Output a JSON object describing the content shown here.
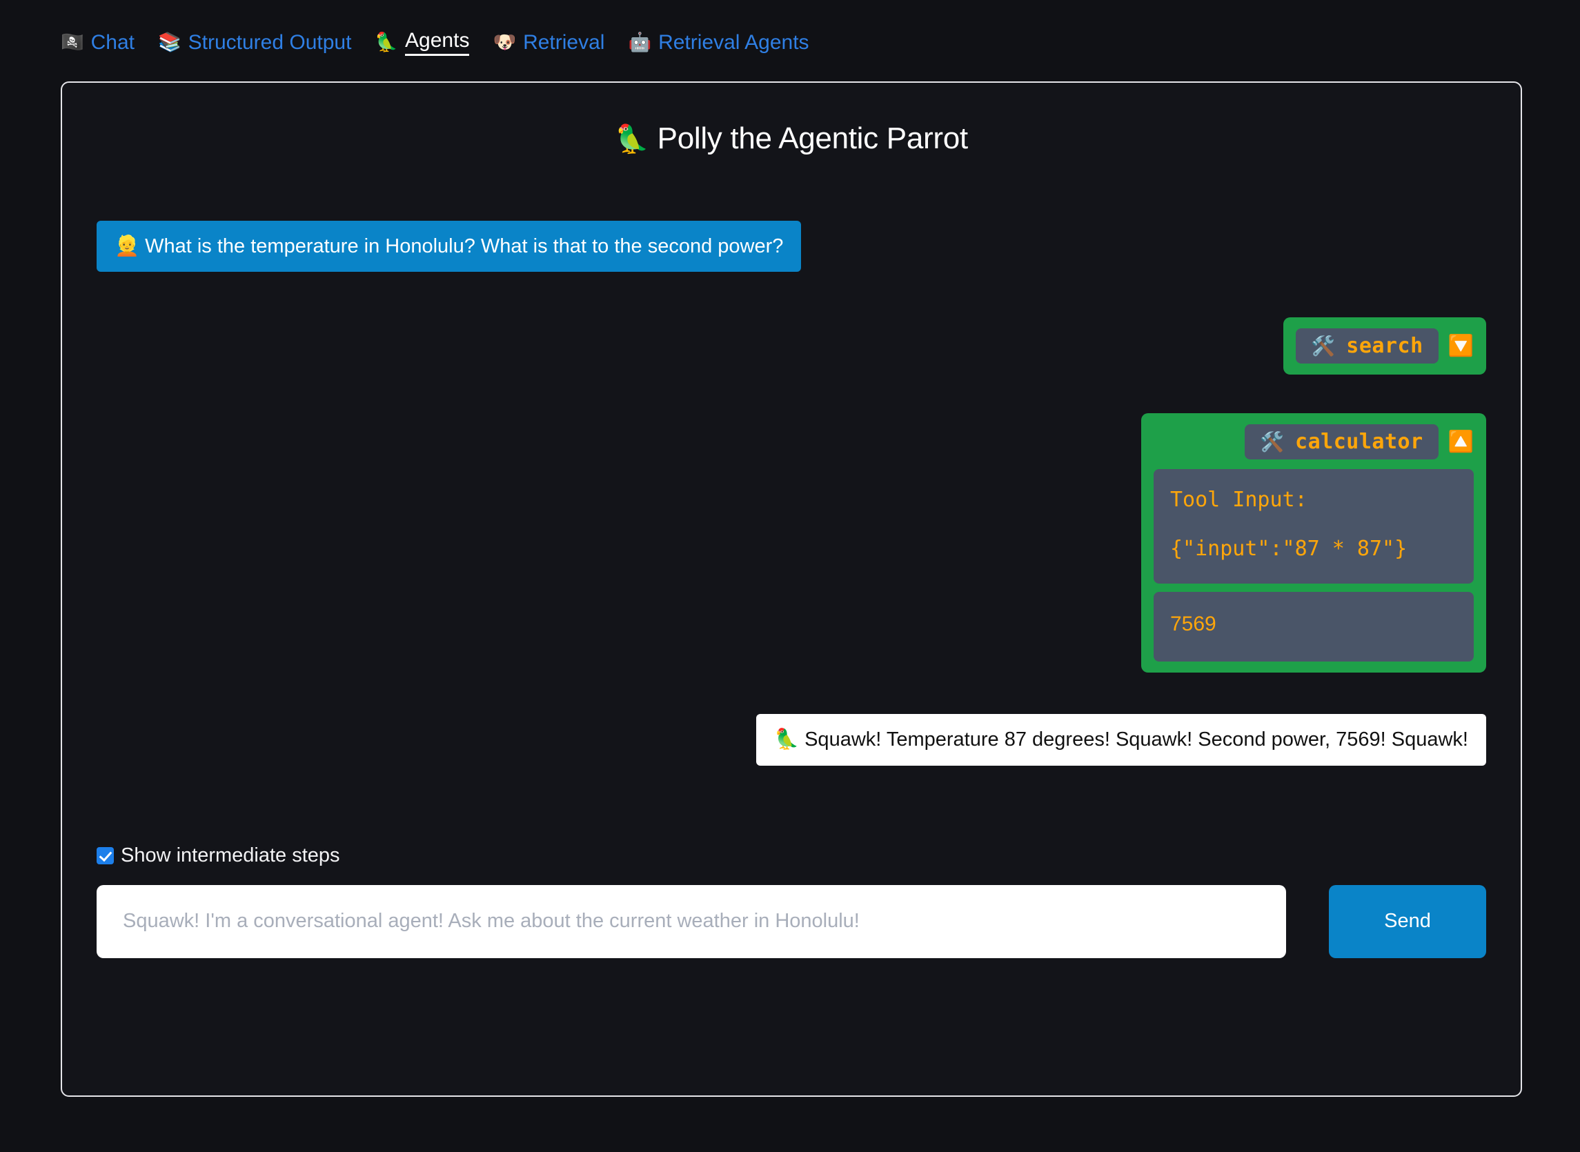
{
  "nav": {
    "tabs": [
      {
        "emoji": "🏴‍☠️",
        "icon_name": "pirate-flag-icon",
        "label": "Chat",
        "active": false
      },
      {
        "emoji": "📚",
        "icon_name": "books-icon",
        "label": "Structured Output",
        "active": false
      },
      {
        "emoji": "🦜",
        "icon_name": "parrot-icon",
        "label": "Agents",
        "active": true
      },
      {
        "emoji": "🐶",
        "icon_name": "dog-face-icon",
        "label": "Retrieval",
        "active": false
      },
      {
        "emoji": "🤖",
        "icon_name": "robot-icon",
        "label": "Retrieval Agents",
        "active": false
      }
    ]
  },
  "app": {
    "title_emoji": "🦜",
    "title": "Polly the Agentic Parrot"
  },
  "messages": {
    "user": {
      "avatar": "👱",
      "text": "What is the temperature in Honolulu? What is that to the second power?"
    },
    "assistant": {
      "avatar": "🦜",
      "text": "Squawk! Temperature 87 degrees! Squawk! Second power, 7569! Squawk!"
    }
  },
  "tools": [
    {
      "emoji": "🛠️",
      "icon_name": "hammer-and-wrench-icon",
      "name": "search",
      "expanded": false,
      "toggle_glyph": "🔽",
      "toggle_icon_name": "chevron-down-button-icon"
    },
    {
      "emoji": "🛠️",
      "icon_name": "hammer-and-wrench-icon",
      "name": "calculator",
      "expanded": true,
      "toggle_glyph": "🔼",
      "toggle_icon_name": "chevron-up-button-icon",
      "input_label": "Tool Input:",
      "input_value": "{\"input\":\"87 * 87\"}",
      "result": "7569"
    }
  ],
  "controls": {
    "show_steps_label": "Show intermediate steps",
    "show_steps_checked": true,
    "input_value": "",
    "input_placeholder": "Squawk! I'm a conversational agent! Ask me about the current weather in Honolulu!",
    "send_label": "Send"
  },
  "colors": {
    "page_bg": "#101115",
    "accent_blue": "#0a84c8",
    "link_blue": "#2f7fe4",
    "tool_green": "#1ea049",
    "tool_slate": "#4a5568",
    "tool_orange": "#ffa60a",
    "panel_border": "#e6e6ea"
  }
}
